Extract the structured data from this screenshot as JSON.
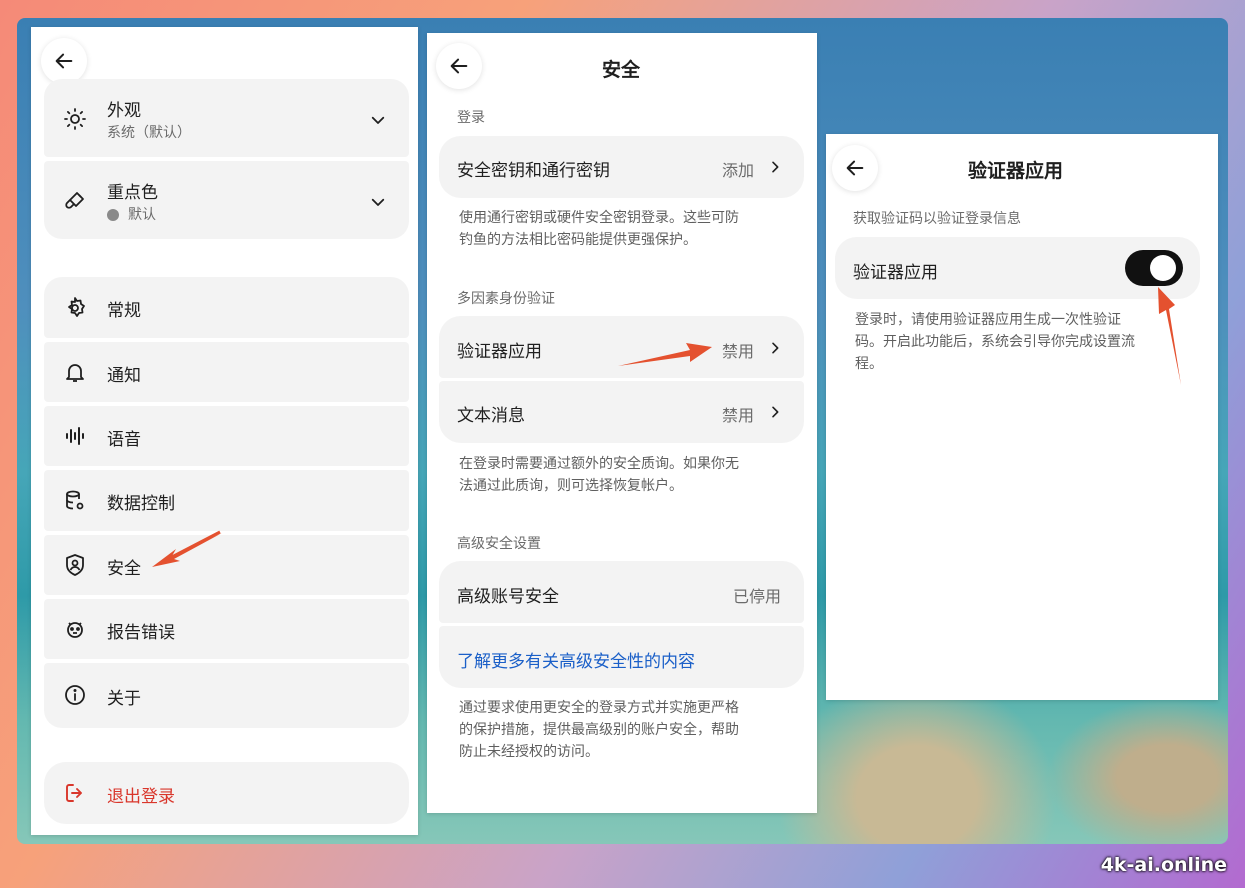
{
  "colors": {
    "accent_red": "#e4512f",
    "link_blue": "#1a5fc8",
    "danger": "#d9362b",
    "toggle_on": "#111111"
  },
  "left_panel": {
    "appearance": {
      "label": "外观",
      "sub": "系统（默认）",
      "icon": "sun-icon"
    },
    "accent": {
      "label": "重点色",
      "sub": "默认",
      "icon": "brush-icon"
    },
    "menu": [
      {
        "label": "常规",
        "icon": "gear-icon"
      },
      {
        "label": "通知",
        "icon": "bell-icon"
      },
      {
        "label": "语音",
        "icon": "waveform-icon"
      },
      {
        "label": "数据控制",
        "icon": "database-gear-icon"
      },
      {
        "label": "安全",
        "icon": "shield-user-icon"
      },
      {
        "label": "报告错误",
        "icon": "bug-icon"
      },
      {
        "label": "关于",
        "icon": "info-icon"
      }
    ],
    "logout": {
      "label": "退出登录",
      "icon": "logout-icon"
    }
  },
  "middle_panel": {
    "title": "安全",
    "login_section": "登录",
    "passkey": {
      "label": "安全密钥和通行密钥",
      "value": "添加"
    },
    "passkey_desc": [
      "使用通行密钥或硬件安全密钥登录。这些可防",
      "钓鱼的方法相比密码能提供更强保护。"
    ],
    "mfa_section": "多因素身份验证",
    "authenticator": {
      "label": "验证器应用",
      "value": "禁用"
    },
    "sms": {
      "label": "文本消息",
      "value": "禁用"
    },
    "mfa_desc": [
      "在登录时需要通过额外的安全质询。如果你无",
      "法通过此质询，则可选择恢复帐户。"
    ],
    "advanced_section": "高级安全设置",
    "advanced": {
      "label": "高级账号安全",
      "value": "已停用"
    },
    "learn_more": "了解更多有关高级安全性的内容",
    "advanced_desc": [
      "通过要求使用更安全的登录方式并实施更严格",
      "的保护措施，提供最高级别的账户安全，帮助",
      "防止未经授权的访问。"
    ]
  },
  "right_panel": {
    "title": "验证器应用",
    "section": "获取验证码以验证登录信息",
    "toggle": {
      "label": "验证器应用",
      "state": "on"
    },
    "desc": [
      "登录时，请使用验证器应用生成一次性验证",
      "码。开启此功能后，系统会引导你完成设置流",
      "程。"
    ]
  },
  "watermark": "4k-ai.online"
}
